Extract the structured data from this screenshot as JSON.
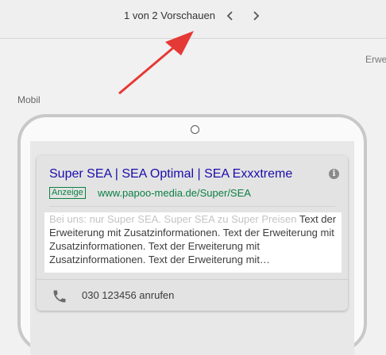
{
  "toolbar": {
    "preview_count": "1 von 2 Vorschauen",
    "prev_icon": "chevron-left-icon",
    "next_icon": "chevron-right-icon"
  },
  "side_label": "Erwe",
  "device_label": "Mobil",
  "ad": {
    "headline": "Super SEA | SEA Optimal | SEA Exxxtreme",
    "badge": "Anzeige",
    "display_url": "www.papoo-media.de/Super/SEA",
    "description_faded": "Bei uns: nur Super SEA. Super SEA zu Super Preisen",
    "description": " Text der Erweiterung mit Zusatzinformationen. Text der Erweiterung mit Zusatzinformationen. Text der Erweiterung mit Zusatzinformationen. Text der Erweiterung mit…",
    "call_extension": "030 123456 anrufen",
    "info_icon": "info-icon",
    "call_icon": "phone-icon"
  },
  "colors": {
    "headline": "#1a0dab",
    "url_green": "#0b8043",
    "annotation_arrow": "#e53935"
  }
}
